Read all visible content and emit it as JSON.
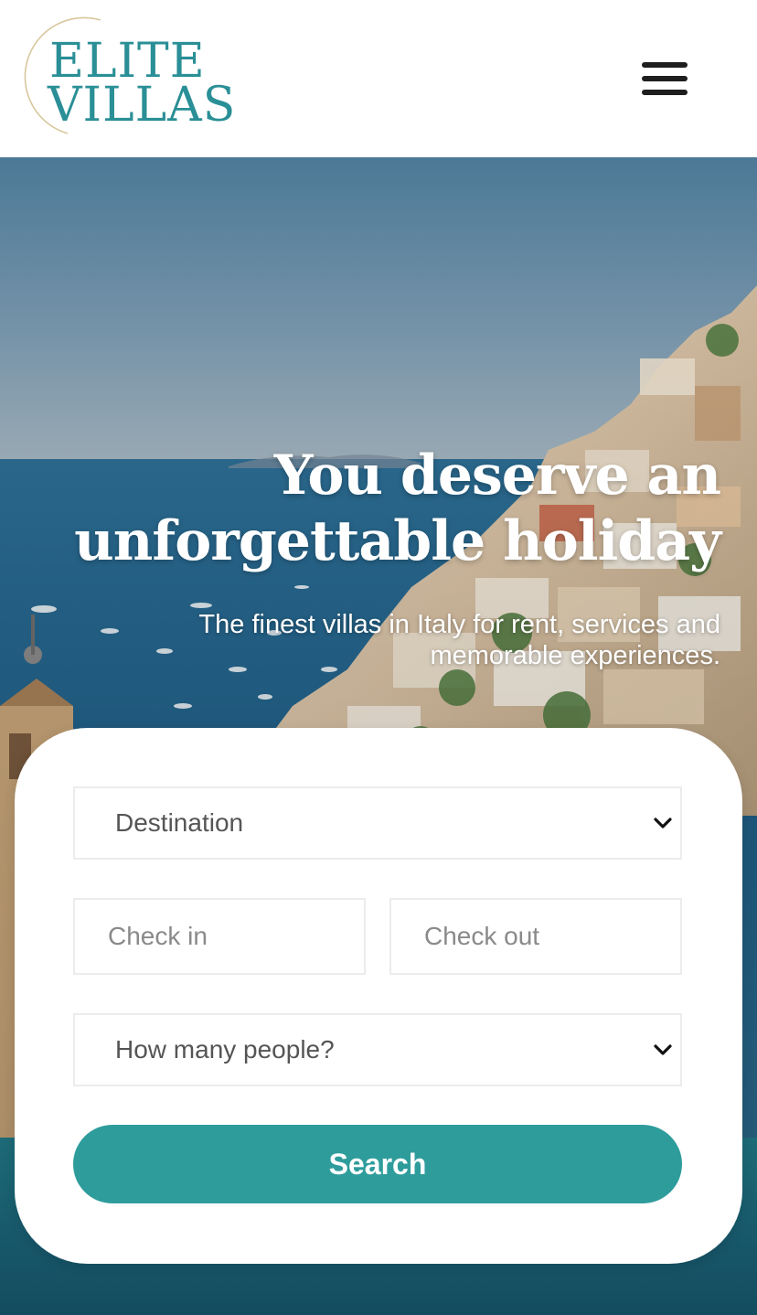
{
  "brand": {
    "line1": "ELITE",
    "line2": "VILLAS",
    "accent_color": "#2a8f96",
    "ring_color": "#c9b07a"
  },
  "header": {
    "menu_icon": "hamburger-menu-icon"
  },
  "hero": {
    "title": "You deserve an unforgettable holiday",
    "subtitle": "The finest villas in Italy for rent, services and memorable experiences."
  },
  "search_form": {
    "destination": "Destination",
    "check_in": "Check in",
    "check_out": "Check out",
    "people": "How many people?",
    "search_label": "Search",
    "button_color": "#2f9c9c",
    "dropdown_icon": "chevron-down-icon"
  }
}
